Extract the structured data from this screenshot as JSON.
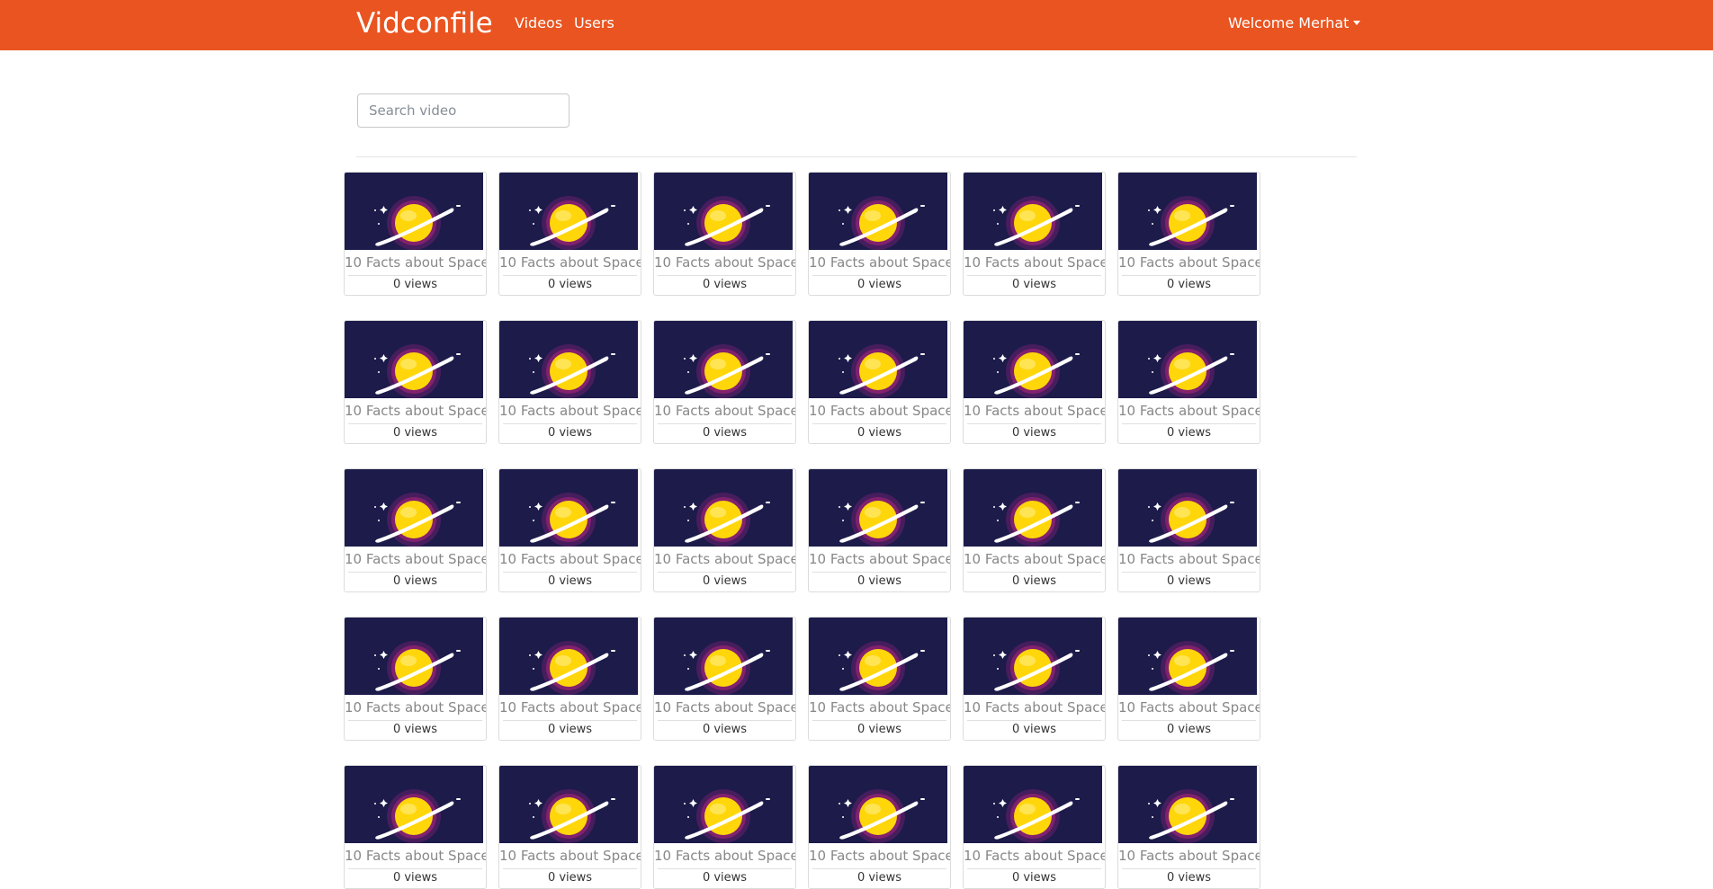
{
  "app": {
    "brand": "Vidconfile",
    "colors": {
      "navbar": "#e95420",
      "thumbnail_bg": "#1c1b4a",
      "planet": "#ffd60a"
    }
  },
  "nav": {
    "links": [
      "Videos",
      "Users"
    ],
    "user_menu": "Welcome Merhat"
  },
  "search": {
    "placeholder": "Search video",
    "value": ""
  },
  "videos": {
    "icon": "planet-thumbnail",
    "items": [
      {
        "title": "10 Facts about Space",
        "views": "0 views"
      },
      {
        "title": "10 Facts about Space",
        "views": "0 views"
      },
      {
        "title": "10 Facts about Space",
        "views": "0 views"
      },
      {
        "title": "10 Facts about Space",
        "views": "0 views"
      },
      {
        "title": "10 Facts about Space",
        "views": "0 views"
      },
      {
        "title": "10 Facts about Space",
        "views": "0 views"
      },
      {
        "title": "10 Facts about Space",
        "views": "0 views"
      },
      {
        "title": "10 Facts about Space",
        "views": "0 views"
      },
      {
        "title": "10 Facts about Space",
        "views": "0 views"
      },
      {
        "title": "10 Facts about Space",
        "views": "0 views"
      },
      {
        "title": "10 Facts about Space",
        "views": "0 views"
      },
      {
        "title": "10 Facts about Space",
        "views": "0 views"
      },
      {
        "title": "10 Facts about Space",
        "views": "0 views"
      },
      {
        "title": "10 Facts about Space",
        "views": "0 views"
      },
      {
        "title": "10 Facts about Space",
        "views": "0 views"
      },
      {
        "title": "10 Facts about Space",
        "views": "0 views"
      },
      {
        "title": "10 Facts about Space",
        "views": "0 views"
      },
      {
        "title": "10 Facts about Space",
        "views": "0 views"
      },
      {
        "title": "10 Facts about Space",
        "views": "0 views"
      },
      {
        "title": "10 Facts about Space",
        "views": "0 views"
      },
      {
        "title": "10 Facts about Space",
        "views": "0 views"
      },
      {
        "title": "10 Facts about Space",
        "views": "0 views"
      },
      {
        "title": "10 Facts about Space",
        "views": "0 views"
      },
      {
        "title": "10 Facts about Space",
        "views": "0 views"
      },
      {
        "title": "10 Facts about Space",
        "views": "0 views"
      },
      {
        "title": "10 Facts about Space",
        "views": "0 views"
      },
      {
        "title": "10 Facts about Space",
        "views": "0 views"
      },
      {
        "title": "10 Facts about Space",
        "views": "0 views"
      },
      {
        "title": "10 Facts about Space",
        "views": "0 views"
      },
      {
        "title": "10 Facts about Space",
        "views": "0 views"
      }
    ]
  }
}
